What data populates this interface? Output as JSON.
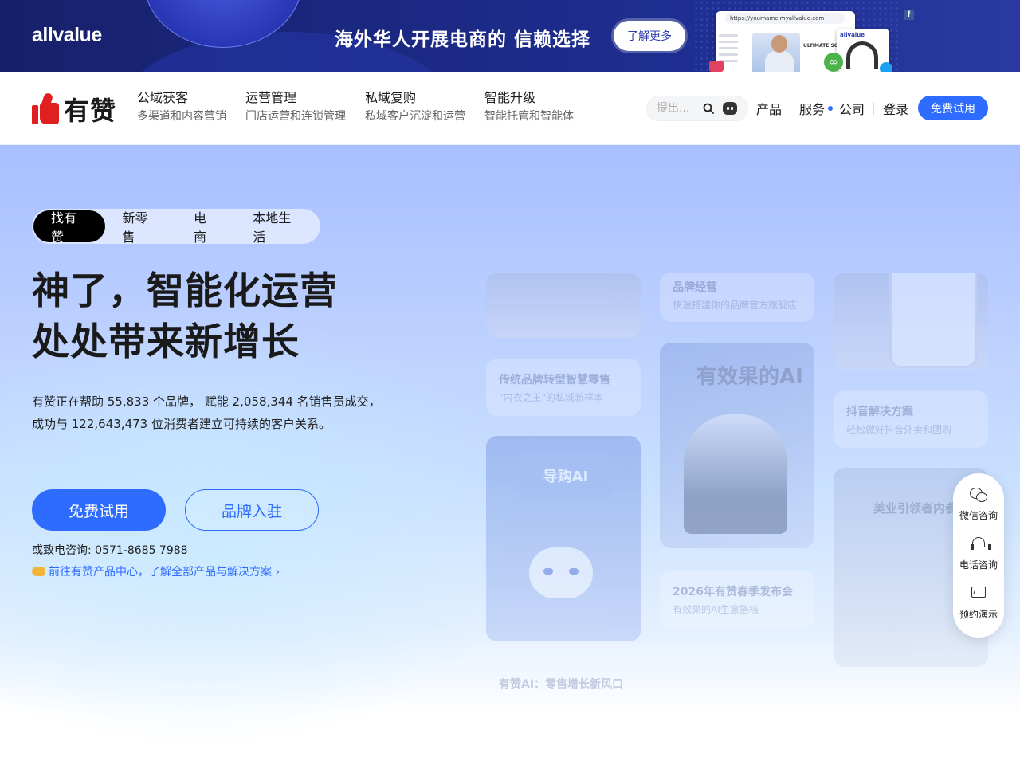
{
  "banner": {
    "logo": "allvalue",
    "slogan": "海外华人开展电商的 信赖选择",
    "learn_more": "了解更多",
    "mock_url": "https://yourname.myallvalue.com",
    "mock_product": "ULTIMATE SOU",
    "mock_phone_logo": "allvalue"
  },
  "nav": {
    "brand": "有赞",
    "menu": [
      {
        "title": "公域获客",
        "sub": "多渠道和内容营销"
      },
      {
        "title": "运营管理",
        "sub": "门店运营和连锁管理"
      },
      {
        "title": "私域复购",
        "sub": "私域客户沉淀和运营"
      },
      {
        "title": "智能升级",
        "sub": "智能托管和智能体"
      }
    ],
    "search_placeholder": "提出...",
    "links": {
      "product": "产品",
      "service": "服务",
      "company": "公司",
      "login": "登录"
    },
    "trial": "免费试用"
  },
  "hero": {
    "tabs": [
      "找有赞",
      "新零售",
      "电商",
      "本地生活"
    ],
    "active_tab": 0,
    "headline_line1": "神了，智能化运营",
    "headline_line2": "处处带来新增长",
    "stats_line1": "有赞正在帮助 55,833 个品牌， 赋能 2,058,344 名销售员成交，",
    "stats_line2": "成功与 122,643,473 位消费者建立可持续的客户关系。",
    "cta_primary": "免费试用",
    "cta_secondary": "品牌入驻",
    "phone": "或致电咨询: 0571-8685 7988",
    "center_link": "前往有赞产品中心，了解全部产品与解决方案 ›"
  },
  "cards": {
    "brand_title": "品牌经营",
    "brand_sub": "快速搭建你的品牌官方旗舰店",
    "retail_title": "传统品牌转型智慧零售",
    "retail_sub": "\"内衣之王\"的私域新样本",
    "ai_big": "有效果的AI",
    "douyin_title": "抖音解决方案",
    "douyin_sub": "轻松做好抖音外卖和团购",
    "guide_ai": "导购AI",
    "spring_title": "2026年有赞春季发布会",
    "spring_sub": "有效果的AI生意搭档",
    "beauty_title": "美业引领者内参",
    "bottom_ghost": "有赞AI：零售增长新风口"
  },
  "float": {
    "wechat": "微信咨询",
    "phone": "电话咨询",
    "demo": "预约演示"
  },
  "colors": {
    "accent": "#2e6bff",
    "brand_red": "#e02020",
    "banner_bg": "#1c2a86"
  }
}
